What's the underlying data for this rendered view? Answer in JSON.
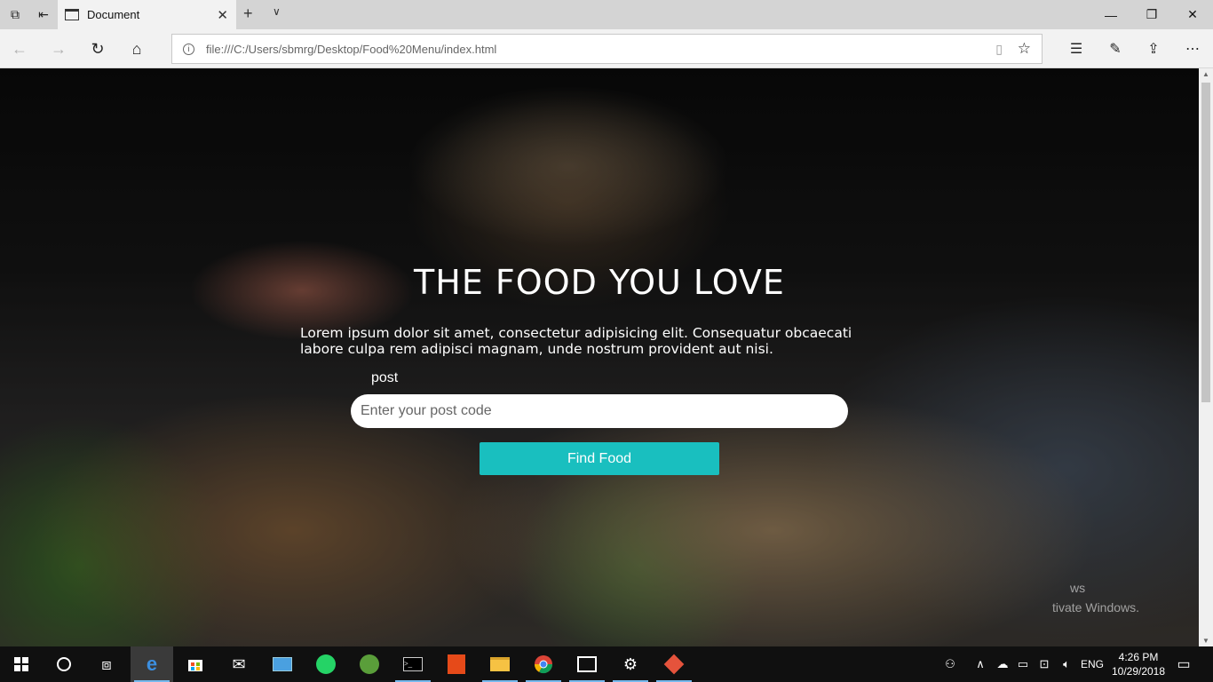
{
  "browser": {
    "tab": {
      "title": "Document"
    },
    "address": {
      "url": "file:///C:/Users/sbmrg/Desktop/Food%20Menu/index.html"
    }
  },
  "page": {
    "headline": "THE FOOD YOU LOVE",
    "lead": "Lorem ipsum dolor sit amet, consectetur adipisicing elit. Consequatur obcaecati labore culpa rem adipisci magnam, unde nostrum provident aut nisi.",
    "post_label": "post",
    "post_placeholder": "Enter your post code",
    "post_value": "",
    "find_button": "Find Food",
    "watermark_line1": "ws",
    "watermark_line2": "tivate Windows."
  },
  "taskbar": {
    "language": "ENG",
    "time": "4:26 PM",
    "date": "10/29/2018"
  },
  "colors": {
    "accent_button": "#19bfbf",
    "taskbar": "#101010",
    "chrome": "#f2f2f2"
  }
}
